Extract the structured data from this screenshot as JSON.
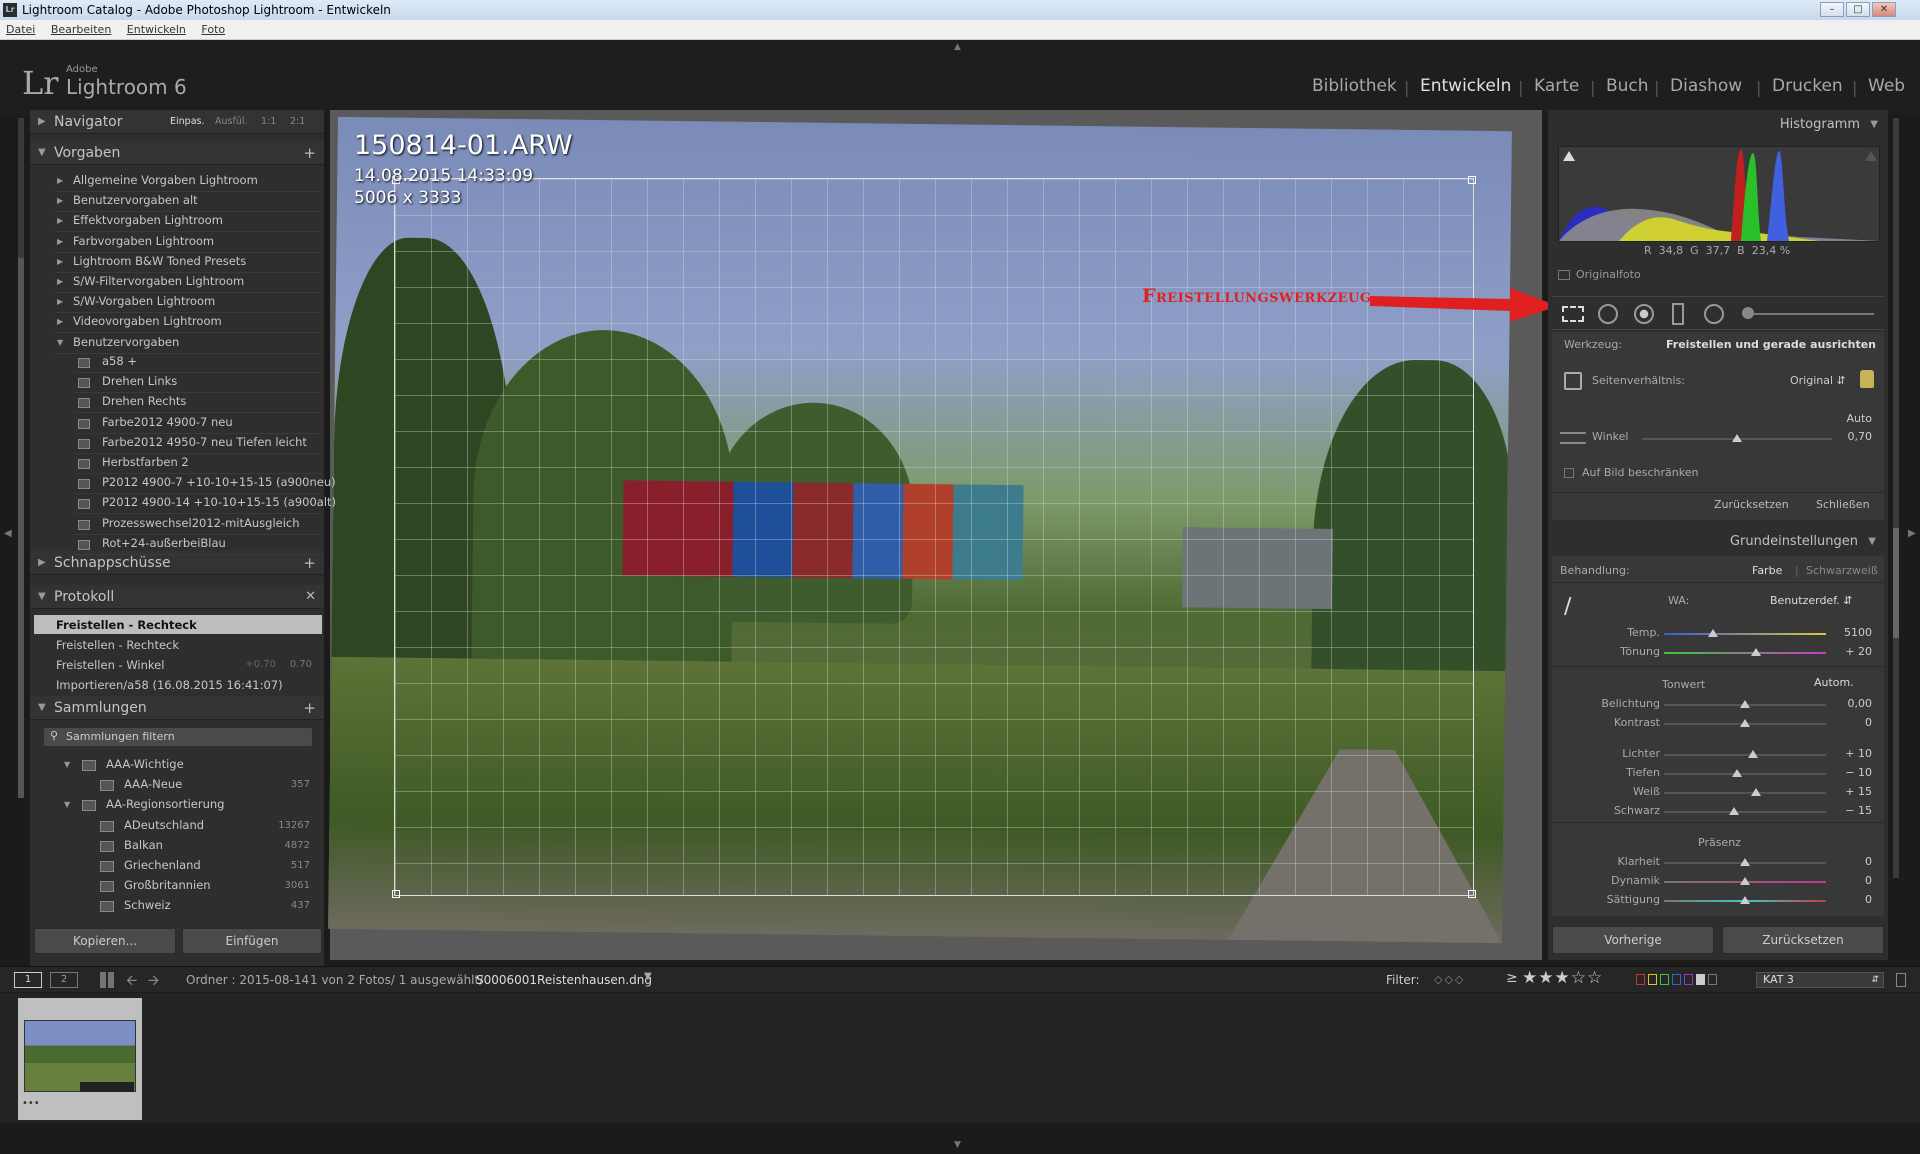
{
  "window": {
    "title": "Lightroom Catalog - Adobe Photoshop Lightroom - Entwickeln",
    "app_icon": "Lr",
    "controls": [
      "minimize-icon",
      "maximize-icon",
      "close-icon"
    ]
  },
  "menu": [
    "Datei",
    "Bearbeiten",
    "Entwickeln",
    "Foto"
  ],
  "brand": {
    "logo": "Lr",
    "adobe": "Adobe",
    "product": "Lightroom 6"
  },
  "modules": [
    "Bibliothek",
    "Entwickeln",
    "Karte",
    "Buch",
    "Diashow",
    "Drucken",
    "Web"
  ],
  "active_module": "Entwickeln",
  "navigator": {
    "label": "Navigator",
    "zoom": [
      "Einpas.",
      "Ausfül.",
      "1:1",
      "2:1"
    ]
  },
  "presets": {
    "label": "Vorgaben",
    "folders": [
      "Allgemeine Vorgaben Lightroom",
      "Benutzervorgaben alt",
      "Effektvorgaben Lightroom",
      "Farbvorgaben Lightroom",
      "Lightroom B&W Toned Presets",
      "S/W-Filtervorgaben Lightroom",
      "S/W-Vorgaben Lightroom",
      "Videovorgaben Lightroom",
      "Benutzervorgaben"
    ],
    "items": [
      "a58 +",
      "Drehen Links",
      "Drehen Rechts",
      "Farbe2012 4900-7 neu",
      "Farbe2012 4950-7 neu Tiefen leicht",
      "Herbstfarben 2",
      "P2012 4900-7 +10-10+15-15 (a900neu)",
      "P2012 4900-14 +10-10+15-15 (a900alt)",
      "Prozesswechsel2012-mitAusgleich",
      "Rot+24-außerbeiBlau"
    ]
  },
  "snapshots": {
    "label": "Schnappschüsse"
  },
  "history": {
    "label": "Protokoll",
    "items": [
      {
        "label": "Freistellen - Rechteck",
        "a": "",
        "b": ""
      },
      {
        "label": "Freistellen - Rechteck",
        "a": "",
        "b": ""
      },
      {
        "label": "Freistellen - Winkel",
        "a": "+0.70",
        "b": "0.70"
      },
      {
        "label": "Importieren/a58 (16.08.2015 16:41:07)",
        "a": "",
        "b": ""
      }
    ]
  },
  "collections": {
    "label": "Sammlungen",
    "filter": "Sammlungen filtern",
    "items": [
      {
        "name": "AAA-Wichtige",
        "count": "",
        "level": 0
      },
      {
        "name": "AAA-Neue",
        "count": "357",
        "level": 1
      },
      {
        "name": "AA-Regionsortierung",
        "count": "",
        "level": 0
      },
      {
        "name": "ADeutschland",
        "count": "13267",
        "level": 1
      },
      {
        "name": "Balkan",
        "count": "4872",
        "level": 1
      },
      {
        "name": "Griechenland",
        "count": "517",
        "level": 1
      },
      {
        "name": "Großbritannien",
        "count": "3061",
        "level": 1
      },
      {
        "name": "Schweiz",
        "count": "437",
        "level": 1
      }
    ]
  },
  "left_buttons": {
    "copy": "Kopieren...",
    "paste": "Einfügen"
  },
  "image_info": {
    "filename": "150814-01.ARW",
    "datetime": "14.08.2015 14:33:09",
    "dimensions": "5006 x 3333"
  },
  "annotation": "Freistellungswerkzeug",
  "histogram": {
    "label": "Histogramm",
    "r": "34,8",
    "g": "37,7",
    "b": "23,4",
    "pct": "%",
    "original": "Originalfoto"
  },
  "tool": {
    "werkzeug": "Werkzeug:",
    "name": "Freistellen und gerade ausrichten",
    "seiten": "Seitenverhältnis:",
    "seiten_val": "Original",
    "auto": "Auto",
    "winkel": "Winkel",
    "winkel_val": "0,70",
    "beschr": "Auf Bild beschränken",
    "reset": "Zurücksetzen",
    "close": "Schließen"
  },
  "basic": {
    "label": "Grundeinstellungen",
    "behandlung": "Behandlung:",
    "farbe": "Farbe",
    "sw": "Schwarzweiß",
    "wa": "WA:",
    "wa_val": "Benutzerdef.",
    "tonwert": "Tonwert",
    "autom": "Autom.",
    "praesenz": "Präsenz"
  },
  "sliders": [
    {
      "label": "Temp.",
      "value": "5100",
      "pos": 0.3,
      "grad": "temp"
    },
    {
      "label": "Tönung",
      "value": "+ 20",
      "pos": 0.57,
      "grad": "tint"
    },
    {
      "label": "Belichtung",
      "value": "0,00",
      "pos": 0.5,
      "grad": ""
    },
    {
      "label": "Kontrast",
      "value": "0",
      "pos": 0.5,
      "grad": ""
    },
    {
      "label": "Lichter",
      "value": "+ 10",
      "pos": 0.55,
      "grad": ""
    },
    {
      "label": "Tiefen",
      "value": "− 10",
      "pos": 0.45,
      "grad": ""
    },
    {
      "label": "Weiß",
      "value": "+ 15",
      "pos": 0.57,
      "grad": ""
    },
    {
      "label": "Schwarz",
      "value": "− 15",
      "pos": 0.43,
      "grad": ""
    },
    {
      "label": "Klarheit",
      "value": "0",
      "pos": 0.5,
      "grad": ""
    },
    {
      "label": "Dynamik",
      "value": "0",
      "pos": 0.5,
      "grad": "dyn"
    },
    {
      "label": "Sättigung",
      "value": "0",
      "pos": 0.5,
      "grad": "sat"
    }
  ],
  "right_buttons": {
    "prev": "Vorherige",
    "reset": "Zurücksetzen"
  },
  "filmstrip": {
    "pages": [
      "1",
      "2"
    ],
    "folder": "Ordner : 2015-08-14",
    "count": "1 von 2 Fotos/ 1 ausgewählt/",
    "file": "S0006001Reistenhausen.dng",
    "filter": "Filter:",
    "rating": "≥",
    "stars": "★★★☆☆",
    "collection": "KAT 3",
    "thumb_stars": "•••"
  },
  "colors": {
    "accent": "#e02020",
    "panel": "#2e2e2e",
    "bg": "#1b1b1b"
  }
}
